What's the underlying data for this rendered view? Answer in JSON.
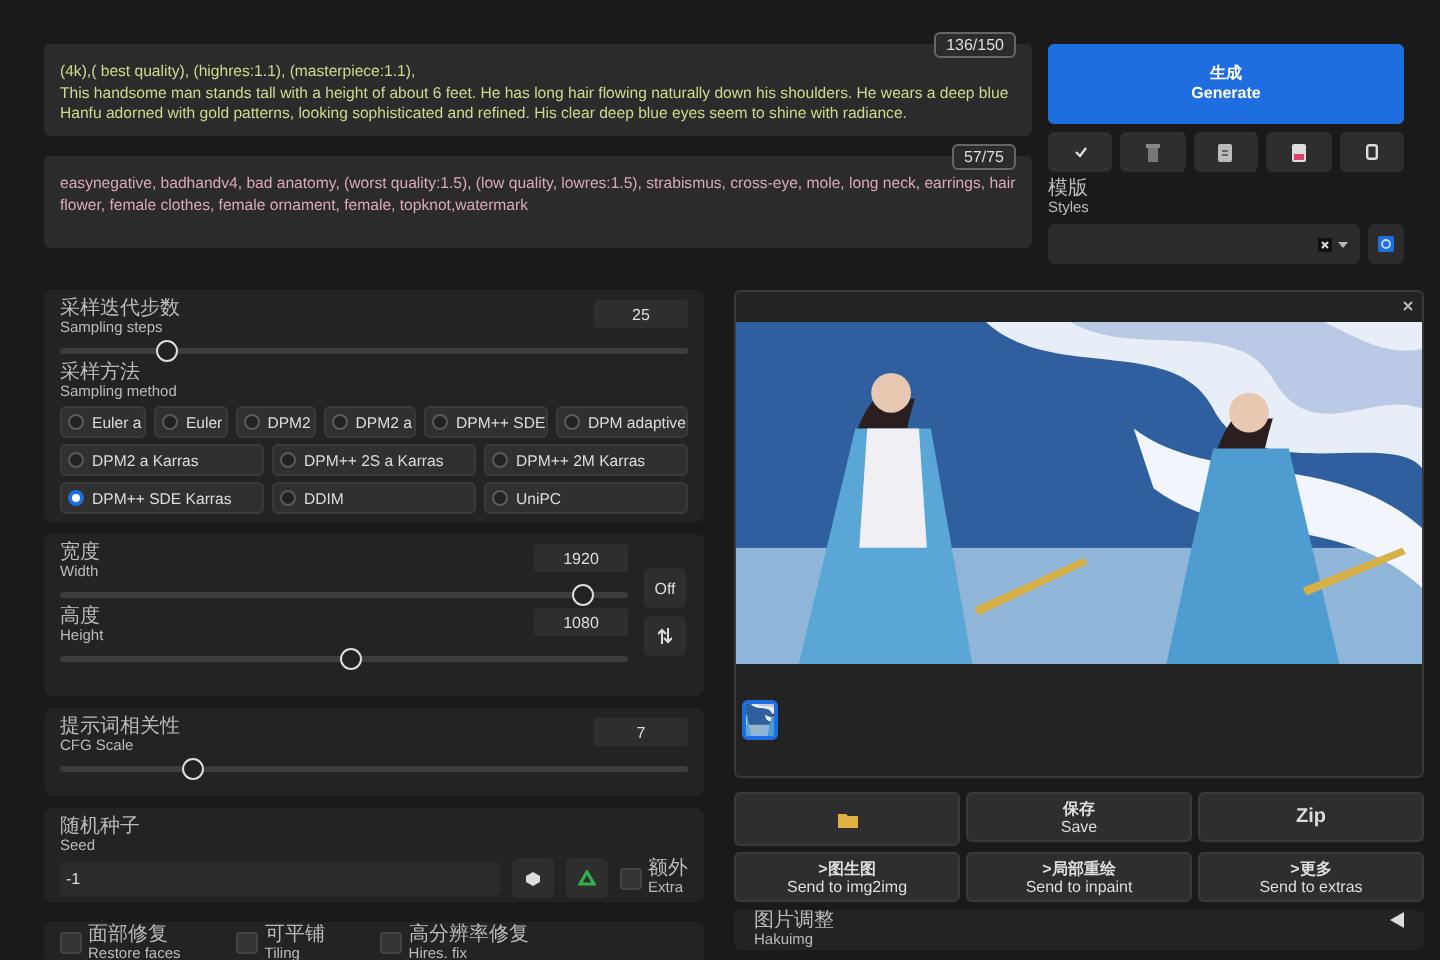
{
  "prompt": {
    "value": "(4k),( best quality), (highres:1.1), (masterpiece:1.1),\nThis handsome man stands tall with a height of about 6 feet. He has long hair flowing naturally down his shoulders. He wears a deep blue Hanfu adorned with gold patterns, looking sophisticated and refined. His clear deep blue eyes seem to shine with radiance.",
    "count": "136/150"
  },
  "negative_prompt": {
    "value": "easynegative, badhandv4, bad anatomy, (worst quality:1.5), (low quality, lowres:1.5), strabismus, cross-eye, mole, long neck, earrings, hair flower, female clothes, female ornament, female, topknot,watermark",
    "count": "57/75"
  },
  "generate_button": {
    "label_zh": "生成",
    "label_en": "Generate"
  },
  "styles": {
    "label_zh": "模版",
    "label_en": "Styles"
  },
  "sampling_steps": {
    "label_zh": "采样迭代步数",
    "label_en": "Sampling steps",
    "value": "25",
    "level": 0.17
  },
  "sampling_method": {
    "label_zh": "采样方法",
    "label_en": "Sampling method",
    "rows": [
      [
        {
          "label": "Euler a",
          "selected": false
        },
        {
          "label": "Euler",
          "selected": false
        },
        {
          "label": "DPM2",
          "selected": false
        },
        {
          "label": "DPM2 a",
          "selected": false
        },
        {
          "label": "DPM++ SDE",
          "selected": false
        },
        {
          "label": "DPM adaptive",
          "selected": false
        }
      ],
      [
        {
          "label": "DPM2 a Karras",
          "selected": false
        },
        {
          "label": "DPM++ 2S a Karras",
          "selected": false
        },
        {
          "label": "DPM++ 2M Karras",
          "selected": false
        }
      ],
      [
        {
          "label": "DPM++ SDE Karras",
          "selected": true
        },
        {
          "label": "DDIM",
          "selected": false
        },
        {
          "label": "UniPC",
          "selected": false
        }
      ]
    ]
  },
  "width": {
    "label_zh": "宽度",
    "label_en": "Width",
    "value": "1920",
    "level": 0.92
  },
  "height": {
    "label_zh": "高度",
    "label_en": "Height",
    "value": "1080",
    "level": 0.51
  },
  "off_button": "Off",
  "cfg_scale": {
    "label_zh": "提示词相关性",
    "label_en": "CFG Scale",
    "value": "7",
    "level": 0.21
  },
  "seed": {
    "label_zh": "随机种子",
    "label_en": "Seed",
    "value": "-1",
    "extra": {
      "label_zh": "额外",
      "label_en": "Extra",
      "checked": false
    }
  },
  "options": [
    {
      "label_zh": "面部修复",
      "label_en": "Restore faces",
      "checked": false
    },
    {
      "label_zh": "可平铺",
      "label_en": "Tiling",
      "checked": false
    },
    {
      "label_zh": "高分辨率修复",
      "label_en": "Hires. fix",
      "checked": false
    }
  ],
  "gallery": {
    "thumbnails": [
      {
        "kind": "picture",
        "selected": true
      }
    ]
  },
  "save_button": {
    "label_zh": "保存",
    "label_en": "Save"
  },
  "zip_button": "Zip",
  "send_buttons": [
    {
      "label_zh": ">图生图",
      "label_en": "Send to img2img"
    },
    {
      "label_zh": ">局部重绘",
      "label_en": "Send to inpaint"
    },
    {
      "label_zh": ">更多",
      "label_en": "Send to extras"
    }
  ],
  "hakuimg": {
    "label_zh": "图片调整",
    "label_en": "Hakuimg"
  }
}
